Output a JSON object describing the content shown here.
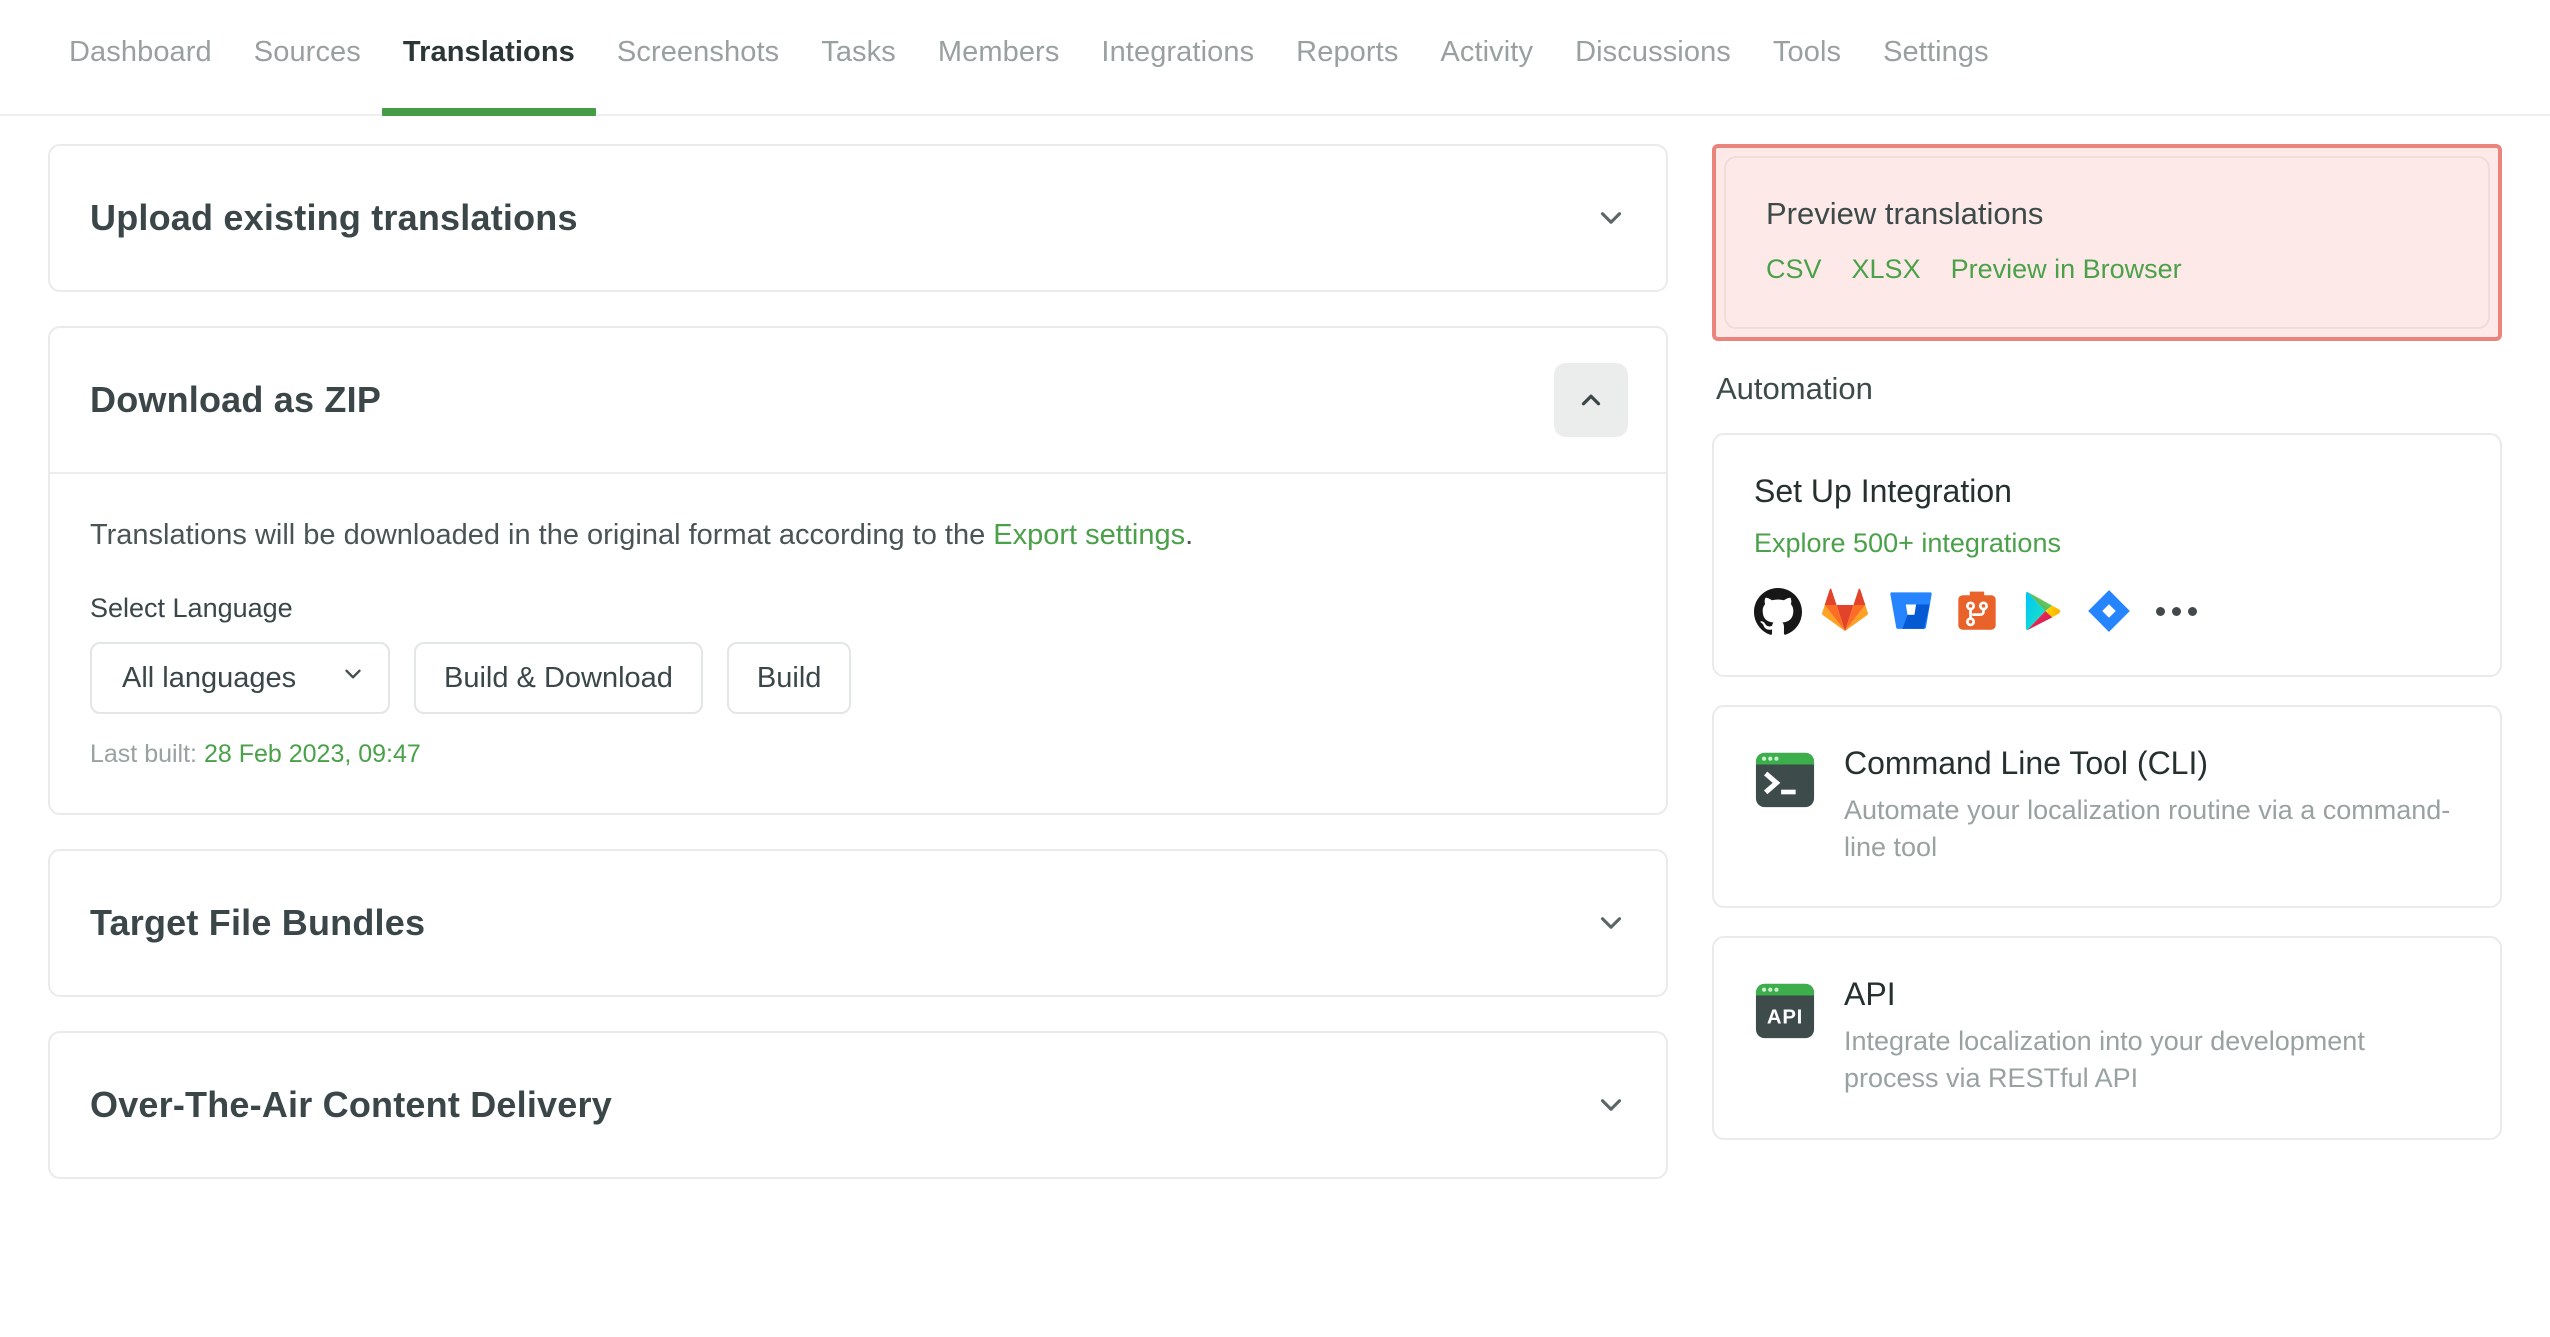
{
  "colors": {
    "green": "#469c46",
    "link_green": "#4aa14a",
    "highlight_border": "#ea847d",
    "highlight_bg": "#fdeae8",
    "text_dark": "#3a4648",
    "text_muted": "#9aa1a1"
  },
  "nav": {
    "items": [
      {
        "label": "Dashboard",
        "active": false
      },
      {
        "label": "Sources",
        "active": false
      },
      {
        "label": "Translations",
        "active": true
      },
      {
        "label": "Screenshots",
        "active": false
      },
      {
        "label": "Tasks",
        "active": false
      },
      {
        "label": "Members",
        "active": false
      },
      {
        "label": "Integrations",
        "active": false
      },
      {
        "label": "Reports",
        "active": false
      },
      {
        "label": "Activity",
        "active": false
      },
      {
        "label": "Discussions",
        "active": false
      },
      {
        "label": "Tools",
        "active": false
      },
      {
        "label": "Settings",
        "active": false
      }
    ]
  },
  "main": {
    "upload_panel": {
      "title": "Upload existing translations",
      "expanded": false
    },
    "zip_panel": {
      "title": "Download as ZIP",
      "expanded": true,
      "description_before": "Translations will be downloaded in the original format according to the ",
      "description_link": "Export settings",
      "description_after": ".",
      "select_label": "Select Language",
      "select_value": "All languages",
      "build_download_label": "Build & Download",
      "build_label": "Build",
      "last_built_label": "Last built:",
      "last_built_value": "28 Feb 2023, 09:47"
    },
    "bundles_panel": {
      "title": "Target File Bundles",
      "expanded": false
    },
    "ota_panel": {
      "title": "Over-The-Air Content Delivery",
      "expanded": false
    }
  },
  "sidebar": {
    "preview": {
      "title": "Preview translations",
      "links": [
        "CSV",
        "XLSX",
        "Preview in Browser"
      ],
      "highlighted": true
    },
    "automation_title": "Automation",
    "integration_card": {
      "title": "Set Up Integration",
      "link": "Explore 500+ integrations",
      "icons": [
        "github-icon",
        "gitlab-icon",
        "bitbucket-icon",
        "azure-repos-icon",
        "google-play-icon",
        "jira-icon",
        "more-icon"
      ]
    },
    "cli_card": {
      "icon": "terminal-icon",
      "title": "Command Line Tool (CLI)",
      "description": "Automate your localization routine via a command-line tool"
    },
    "api_card": {
      "icon": "api-icon",
      "title": "API",
      "description": "Integrate localization into your development process via RESTful API"
    }
  }
}
